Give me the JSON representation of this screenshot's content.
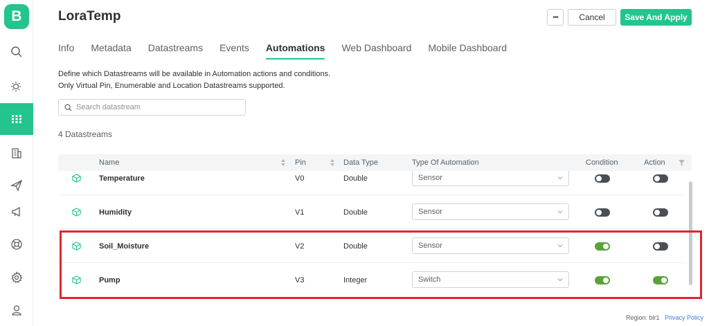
{
  "app": {
    "logo_letter": "B",
    "title": "LoraTemp"
  },
  "sidebar": {
    "items": [
      {
        "icon": "search-icon"
      },
      {
        "icon": "sun-icon"
      },
      {
        "icon": "grid-icon",
        "active": true
      },
      {
        "icon": "building-icon"
      },
      {
        "icon": "send-icon"
      },
      {
        "icon": "megaphone-icon"
      },
      {
        "icon": "lifebuoy-icon"
      },
      {
        "icon": "gear-icon"
      },
      {
        "icon": "user-icon"
      }
    ]
  },
  "header": {
    "more_label": "•••",
    "cancel_label": "Cancel",
    "save_label": "Save And Apply"
  },
  "tabs": [
    {
      "label": "Info"
    },
    {
      "label": "Metadata"
    },
    {
      "label": "Datastreams"
    },
    {
      "label": "Events"
    },
    {
      "label": "Automations",
      "active": true
    },
    {
      "label": "Web Dashboard"
    },
    {
      "label": "Mobile Dashboard"
    }
  ],
  "description": {
    "line1": "Define which Datastreams will be available in Automation actions and conditions.",
    "line2": "Only Virtual Pin, Enumerable and Location Datastreams supported."
  },
  "search": {
    "placeholder": "Search datastream",
    "value": ""
  },
  "count_label": "4 Datastreams",
  "table": {
    "columns": {
      "name": "Name",
      "pin": "Pin",
      "data_type": "Data Type",
      "automation_type": "Type Of Automation",
      "condition": "Condition",
      "action": "Action"
    },
    "rows": [
      {
        "name": "Temperature",
        "pin": "V0",
        "data_type": "Double",
        "automation": "Sensor",
        "condition": false,
        "action": false
      },
      {
        "name": "Humidity",
        "pin": "V1",
        "data_type": "Double",
        "automation": "Sensor",
        "condition": false,
        "action": false
      },
      {
        "name": "Soil_Moisture",
        "pin": "V2",
        "data_type": "Double",
        "automation": "Sensor",
        "condition": true,
        "action": false
      },
      {
        "name": "Pump",
        "pin": "V3",
        "data_type": "Integer",
        "automation": "Switch",
        "condition": true,
        "action": true
      }
    ]
  },
  "footer": {
    "region": "Region: blr1",
    "privacy": "Privacy Policy"
  },
  "colors": {
    "accent": "#23c48e",
    "toggle_on": "#5aa33a",
    "toggle_off": "#4a4f54",
    "highlight": "#e0252b"
  }
}
